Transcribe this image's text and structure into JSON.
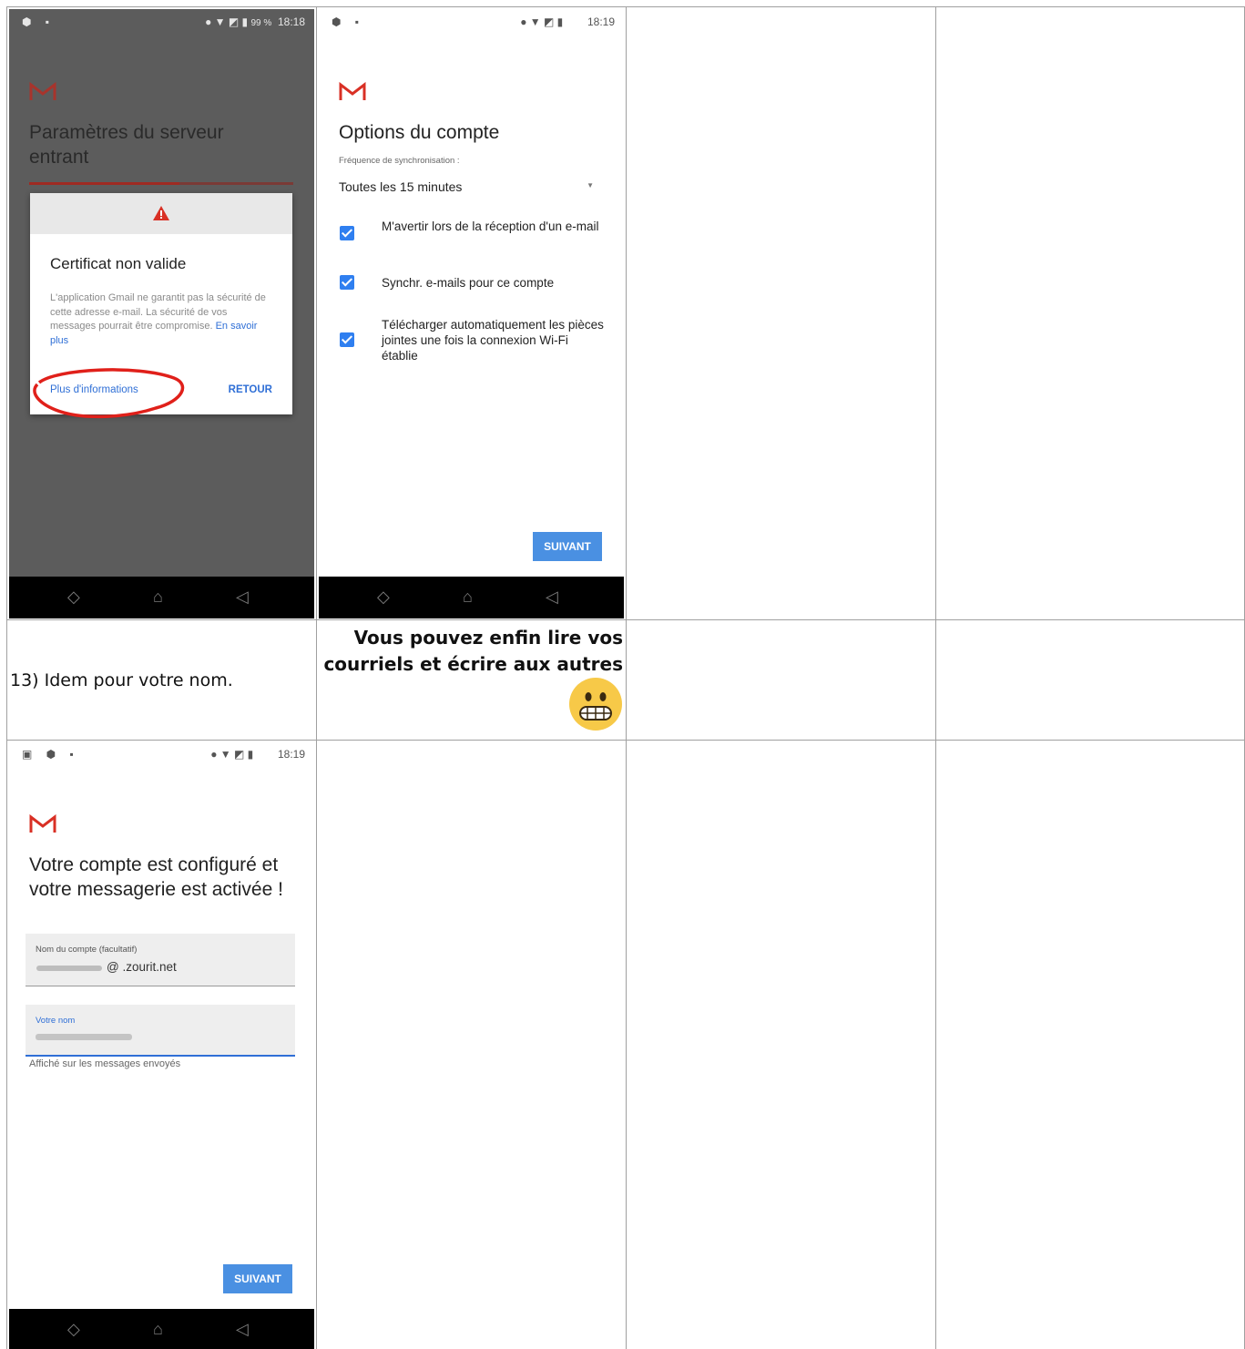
{
  "screen1": {
    "status_time": "18:18",
    "status_battery": "99 %",
    "title": "Paramètres du serveur entrant",
    "dialog": {
      "title": "Certificat non valide",
      "body": "L'application Gmail ne garantit pas la sécurité de cette adresse e-mail. La sécurité de vos messages pourrait être compromise.",
      "learn_more": "En savoir plus",
      "more_info": "Plus d'informations",
      "back": "RETOUR"
    }
  },
  "screen2": {
    "status_time": "18:19",
    "title": "Options du compte",
    "sync_label": "Fréquence de synchronisation :",
    "sync_value": "Toutes les 15 minutes",
    "options": [
      "M'avertir lors de la réception d'un e-mail",
      "Synchr. e-mails pour ce compte",
      "Télécharger automatiquement les pièces jointes une fois la connexion Wi-Fi établie"
    ],
    "next": "SUIVANT"
  },
  "row2": {
    "step13": "13) Idem pour votre nom.",
    "final_message": "Vous pouvez enfin lire vos courriels et écrire aux autres"
  },
  "screen3": {
    "status_time": "18:19",
    "title": "Votre compte est configuré et votre messagerie est activée !",
    "account_label": "Nom du compte (facultatif)",
    "account_value": "@ .zourit.net",
    "name_label": "Votre nom",
    "name_hint": "Affiché sur les messages envoyés",
    "next": "SUIVANT"
  },
  "colors": {
    "gmail_red": "#d93025",
    "accent_blue": "#4a90e2"
  }
}
